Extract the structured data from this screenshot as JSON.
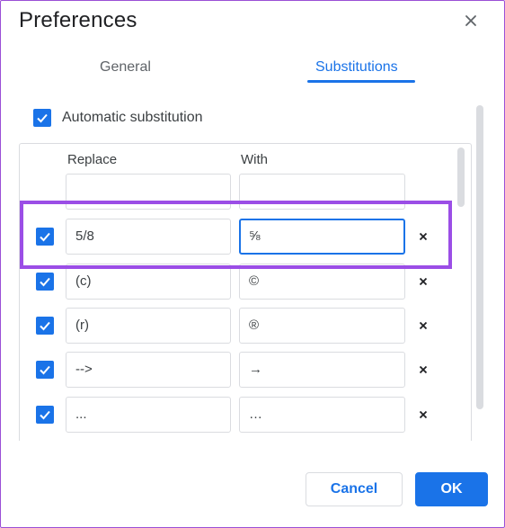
{
  "dialog": {
    "title": "Preferences",
    "tabs": [
      {
        "label": "General",
        "active": false
      },
      {
        "label": "Substitutions",
        "active": true
      }
    ]
  },
  "automatic": {
    "label": "Automatic substitution",
    "checked": true
  },
  "table": {
    "headers": {
      "replace": "Replace",
      "with": "With"
    },
    "new_row": {
      "replace": "",
      "with": ""
    },
    "rows": [
      {
        "replace": "5/8",
        "with": "⅝",
        "checked": true,
        "highlighted": true
      },
      {
        "replace": "(c)",
        "with": "©",
        "checked": true
      },
      {
        "replace": "(r)",
        "with": "®",
        "checked": true
      },
      {
        "replace": "-->",
        "with": "→",
        "checked": true
      },
      {
        "replace": "...",
        "with": "…",
        "checked": true
      }
    ]
  },
  "buttons": {
    "cancel": "Cancel",
    "ok": "OK"
  },
  "colors": {
    "accent": "#1a73e8",
    "highlight": "#9b4ee6"
  },
  "icons": {
    "close": "close-icon",
    "check": "check-icon",
    "delete": "delete-row-icon"
  }
}
